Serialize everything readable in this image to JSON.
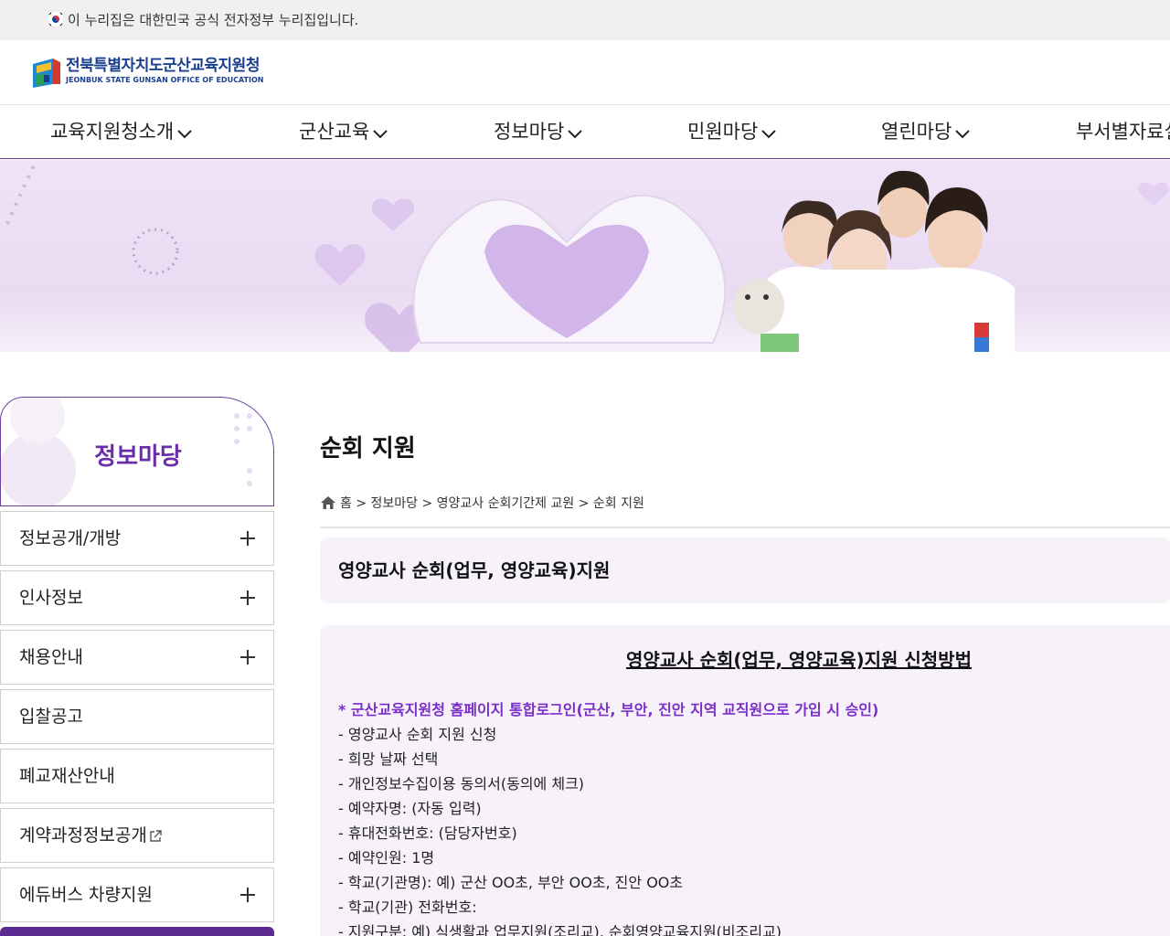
{
  "gov_banner": {
    "text": "이 누리집은 대한민국 공식 전자정부 누리집입니다."
  },
  "logo": {
    "title_ko": "전북특별자치도군산교육지원청",
    "title_en": "JEONBUK STATE GUNSAN OFFICE OF EDUCATION"
  },
  "nav": {
    "items": [
      {
        "label": "교육지원청소개"
      },
      {
        "label": "군산교육"
      },
      {
        "label": "정보마당"
      },
      {
        "label": "민원마당"
      },
      {
        "label": "열린마당"
      },
      {
        "label": "부서별자료실"
      }
    ]
  },
  "sidebar": {
    "title": "정보마당",
    "items": [
      {
        "label": "정보공개/개방",
        "expandable": true
      },
      {
        "label": "인사정보",
        "expandable": true
      },
      {
        "label": "채용안내",
        "expandable": true
      },
      {
        "label": "입찰공고",
        "expandable": false
      },
      {
        "label": "폐교재산안내",
        "expandable": false
      },
      {
        "label": "계약과정정보공개",
        "expandable": false,
        "external": true
      },
      {
        "label": "에듀버스 차량지원",
        "expandable": true
      }
    ]
  },
  "main": {
    "title": "순회 지원",
    "breadcrumb": "홈 > 정보마당 > 영양교사 순회기간제 교원 > 순회 지원",
    "section_title": "영양교사 순회(업무, 영양교육)지원",
    "content": {
      "heading": "영양교사 순회(업무, 영양교육)지원 신청방법",
      "notice": "* 군산교육지원청 홈페이지 통합로그인(군산, 부안, 진안 지역 교직원으로 가입 시 승인)",
      "lines": [
        "- 영양교사 순회 지원 신청",
        "- 희망 날짜 선택",
        "- 개인정보수집이용 동의서(동의에 체크)",
        "- 예약자명: (자동 입력)",
        "- 휴대전화번호: (담당자번호)",
        "- 예약인원: 1명",
        "- 학교(기관명): 예) 군산 OO초, 부안 OO초, 진안 OO초",
        "- 학교(기관) 전화번호:",
        "- 지원구분: 예) 식생활과 업무지원(조리교), 순회영양교육지원(비조리교)"
      ]
    }
  },
  "colors": {
    "accent": "#6a2fa8",
    "notice": "#7b2fc9",
    "logo": "#1b3f8f",
    "box_bg": "#f7f2fa"
  }
}
